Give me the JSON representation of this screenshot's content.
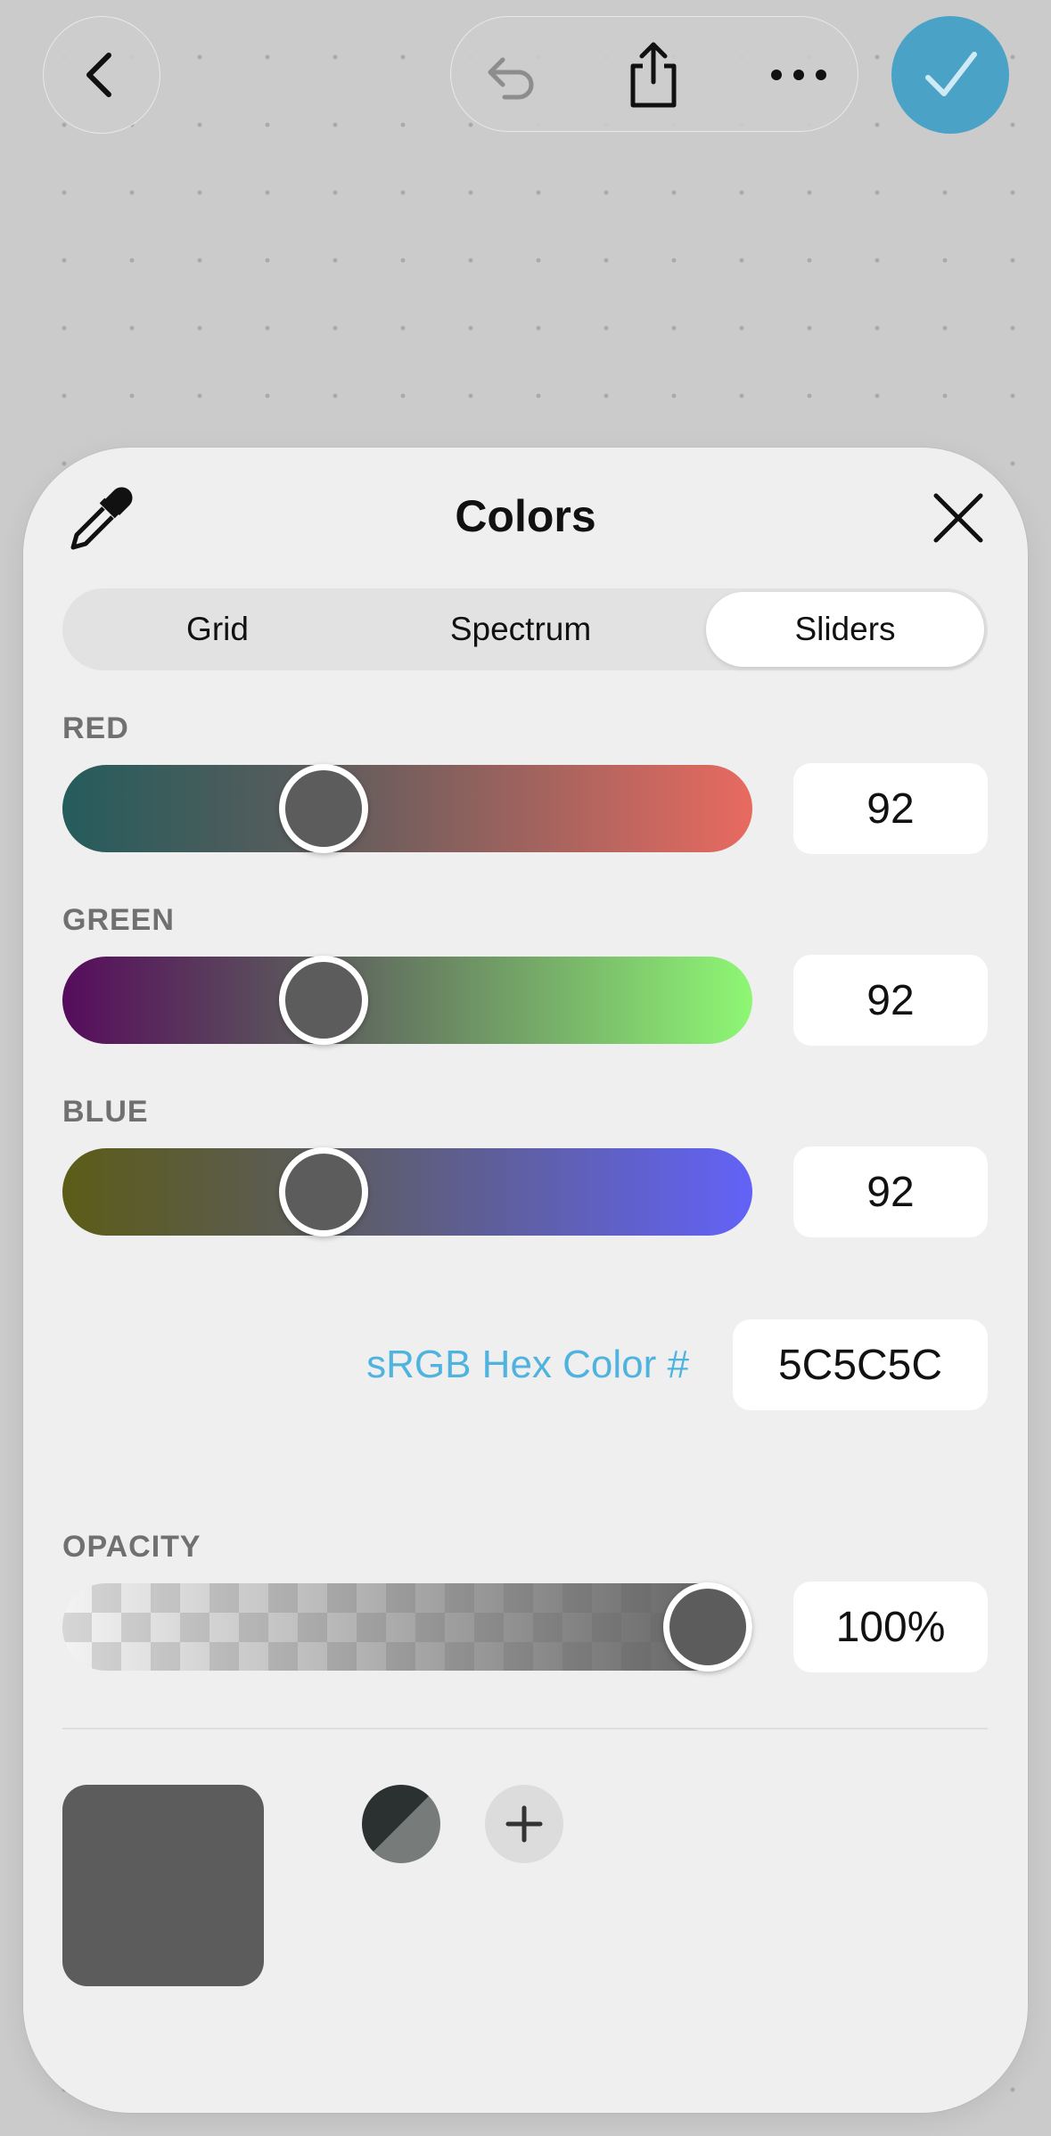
{
  "toolbar": {
    "back_icon": "chevron-left-icon",
    "undo_icon": "undo-icon",
    "share_icon": "share-icon",
    "more_icon": "ellipsis-icon",
    "done_icon": "checkmark-icon",
    "done_color": "#4aa3c7"
  },
  "sheet": {
    "title": "Colors",
    "eyedropper_icon": "eyedropper-icon",
    "close_icon": "close-icon"
  },
  "tabs": [
    {
      "label": "Grid",
      "active": false
    },
    {
      "label": "Spectrum",
      "active": false
    },
    {
      "label": "Sliders",
      "active": true
    }
  ],
  "sliders": {
    "red": {
      "label": "RED",
      "value": "92",
      "level": 0.36
    },
    "green": {
      "label": "GREEN",
      "value": "92",
      "level": 0.36
    },
    "blue": {
      "label": "BLUE",
      "value": "92",
      "level": 0.36
    }
  },
  "hex": {
    "label": "sRGB Hex Color #",
    "value": "5C5C5C",
    "label_color": "#4fb3e0"
  },
  "opacity": {
    "label": "OPACITY",
    "value": "100%",
    "level": 1.0
  },
  "current_color": "#5c5c5c",
  "swatches": {
    "add_icon": "plus-icon"
  }
}
